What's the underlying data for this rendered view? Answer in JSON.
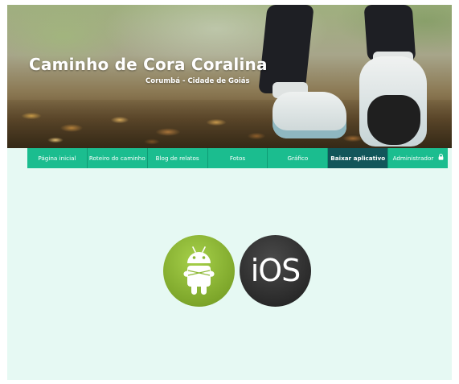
{
  "site": {
    "title": "Caminho de Cora Coralina",
    "subtitle": "Corumbá - Cidade de Goiás"
  },
  "nav": {
    "items": [
      {
        "label": "Página inicial",
        "active": false
      },
      {
        "label": "Roteiro do caminho",
        "active": false
      },
      {
        "label": "Blog de relatos",
        "active": false
      },
      {
        "label": "Fotos",
        "active": false
      },
      {
        "label": "Gráfico",
        "active": false
      },
      {
        "label": "Baixar aplicativo",
        "active": true
      },
      {
        "label": "Administrador",
        "active": false,
        "icon": "lock-icon"
      }
    ]
  },
  "apps": {
    "android": {
      "icon": "android-icon",
      "color": "#8cb833"
    },
    "ios": {
      "label": "iOS",
      "icon": "ios-icon",
      "color": "#2e2e2e"
    }
  },
  "colors": {
    "nav": "#1bbd8f",
    "nav_active": "#12565a",
    "page_background": "#e6f9f3"
  }
}
